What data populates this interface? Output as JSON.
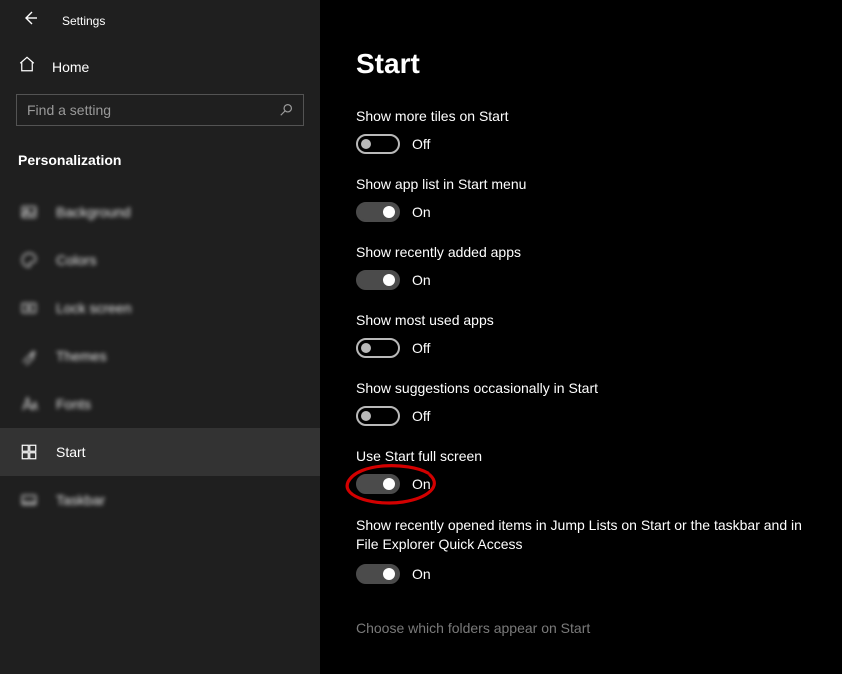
{
  "app_title": "Settings",
  "home_label": "Home",
  "search": {
    "placeholder": "Find a setting"
  },
  "section_header": "Personalization",
  "nav": [
    {
      "label": "Background",
      "selected": false
    },
    {
      "label": "Colors",
      "selected": false
    },
    {
      "label": "Lock screen",
      "selected": false
    },
    {
      "label": "Themes",
      "selected": false
    },
    {
      "label": "Fonts",
      "selected": false
    },
    {
      "label": "Start",
      "selected": true
    },
    {
      "label": "Taskbar",
      "selected": false
    }
  ],
  "page_title": "Start",
  "settings": [
    {
      "label": "Show more tiles on Start",
      "on": false,
      "state": "Off"
    },
    {
      "label": "Show app list in Start menu",
      "on": true,
      "state": "On"
    },
    {
      "label": "Show recently added apps",
      "on": true,
      "state": "On"
    },
    {
      "label": "Show most used apps",
      "on": false,
      "state": "Off"
    },
    {
      "label": "Show suggestions occasionally in Start",
      "on": false,
      "state": "Off"
    },
    {
      "label": "Use Start full screen",
      "on": true,
      "state": "On",
      "highlighted": true
    },
    {
      "label": "Show recently opened items in Jump Lists on Start or the taskbar and in File Explorer Quick Access",
      "on": true,
      "state": "On"
    }
  ],
  "footer_link": "Choose which folders appear on Start",
  "annotation": {
    "color": "#d30000"
  }
}
